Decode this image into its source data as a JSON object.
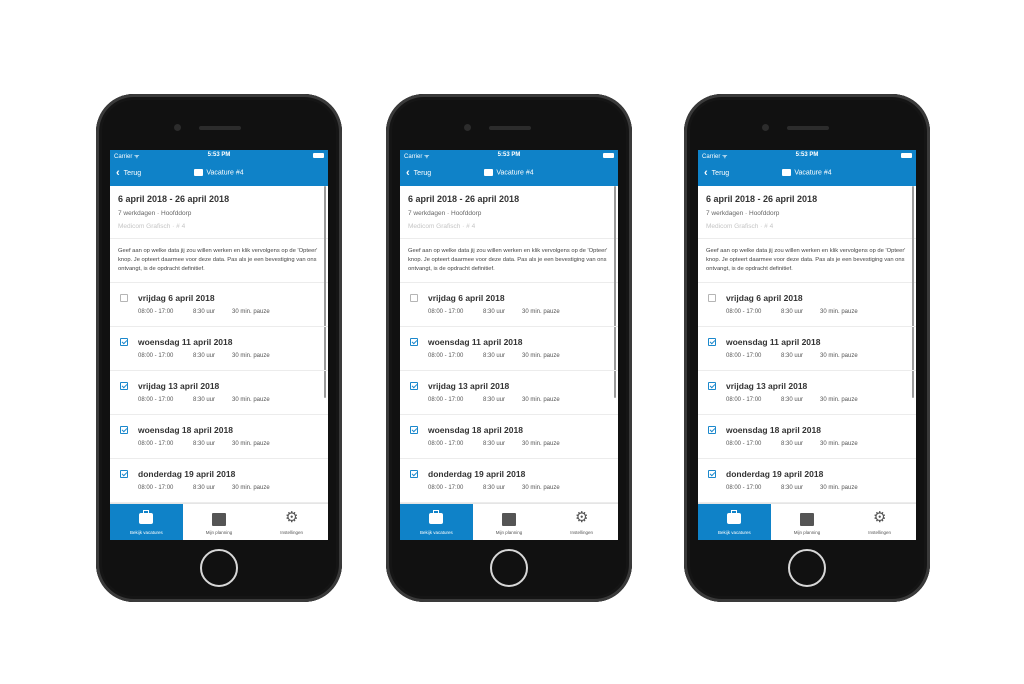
{
  "phones": [
    {
      "status": {
        "carrier": "Carrier ᯤ",
        "time": "5:53 PM"
      },
      "nav": {
        "back_label": "Terug",
        "title": "Vacature #4"
      },
      "header": {
        "dates": "6 april 2018 - 26 april 2018",
        "location": "7 werkdagen · Hoofddorp",
        "company": "Medicom Grafisch · # 4"
      },
      "intro": "Geef aan op welke data jij zou willen werken en klik vervolgens op de 'Opteer' knop. Je opteert daarmee voor deze data. Pas als je een bevestiging van ons ontvangt, is de opdracht definitief.",
      "days": [
        {
          "name": "vrijdag 6 april 2018",
          "hours": "08:00 - 17:00",
          "duration": "8:30 uur",
          "pause": "30 min. pauze",
          "checked": false
        },
        {
          "name": "woensdag 11 april 2018",
          "hours": "08:00 - 17:00",
          "duration": "8:30 uur",
          "pause": "30 min. pauze",
          "checked": true
        },
        {
          "name": "vrijdag 13 april 2018",
          "hours": "08:00 - 17:00",
          "duration": "8:30 uur",
          "pause": "30 min. pauze",
          "checked": true
        },
        {
          "name": "woensdag 18 april 2018",
          "hours": "08:00 - 17:00",
          "duration": "8:30 uur",
          "pause": "30 min. pauze",
          "checked": true
        },
        {
          "name": "donderdag 19 april 2018",
          "hours": "08:00 - 17:00",
          "duration": "8:30 uur",
          "pause": "30 min. pauze",
          "checked": true
        }
      ],
      "tabs": [
        {
          "label": "Bekijk vacatures",
          "icon": "briefcase-icon"
        },
        {
          "label": "Mijn planning",
          "icon": "calendar-icon"
        },
        {
          "label": "Instellingen",
          "icon": "gears-icon"
        }
      ]
    },
    {
      "status": {
        "carrier": "Carrier ᯤ",
        "time": "5:53 PM"
      },
      "nav": {
        "back_label": "Terug",
        "title": "Vacature #4"
      },
      "header": {
        "dates": "6 april 2018 - 26 april 2018",
        "location": "7 werkdagen · Hoofddorp",
        "company": "Medicom Grafisch · # 4"
      },
      "intro": "Geef aan op welke data jij zou willen werken en klik vervolgens op de 'Opteer' knop. Je opteert daarmee voor deze data. Pas als je een bevestiging van ons ontvangt, is de opdracht definitief.",
      "days": [
        {
          "name": "vrijdag 6 april 2018",
          "hours": "08:00 - 17:00",
          "duration": "8:30 uur",
          "pause": "30 min. pauze",
          "checked": false
        },
        {
          "name": "woensdag 11 april 2018",
          "hours": "08:00 - 17:00",
          "duration": "8:30 uur",
          "pause": "30 min. pauze",
          "checked": true
        },
        {
          "name": "vrijdag 13 april 2018",
          "hours": "08:00 - 17:00",
          "duration": "8:30 uur",
          "pause": "30 min. pauze",
          "checked": true
        },
        {
          "name": "woensdag 18 april 2018",
          "hours": "08:00 - 17:00",
          "duration": "8:30 uur",
          "pause": "30 min. pauze",
          "checked": true
        },
        {
          "name": "donderdag 19 april 2018",
          "hours": "08:00 - 17:00",
          "duration": "8:30 uur",
          "pause": "30 min. pauze",
          "checked": true
        }
      ],
      "tabs": [
        {
          "label": "Bekijk vacatures",
          "icon": "briefcase-icon"
        },
        {
          "label": "Mijn planning",
          "icon": "calendar-icon"
        },
        {
          "label": "Instellingen",
          "icon": "gears-icon"
        }
      ]
    },
    {
      "status": {
        "carrier": "Carrier ᯤ",
        "time": "5:53 PM"
      },
      "nav": {
        "back_label": "Terug",
        "title": "Vacature #4"
      },
      "header": {
        "dates": "6 april 2018 - 26 april 2018",
        "location": "7 werkdagen · Hoofddorp",
        "company": "Medicom Grafisch · # 4"
      },
      "intro": "Geef aan op welke data jij zou willen werken en klik vervolgens op de 'Opteer' knop. Je opteert daarmee voor deze data. Pas als je een bevestiging van ons ontvangt, is de opdracht definitief.",
      "days": [
        {
          "name": "vrijdag 6 april 2018",
          "hours": "08:00 - 17:00",
          "duration": "8:30 uur",
          "pause": "30 min. pauze",
          "checked": false
        },
        {
          "name": "woensdag 11 april 2018",
          "hours": "08:00 - 17:00",
          "duration": "8:30 uur",
          "pause": "30 min. pauze",
          "checked": true
        },
        {
          "name": "vrijdag 13 april 2018",
          "hours": "08:00 - 17:00",
          "duration": "8:30 uur",
          "pause": "30 min. pauze",
          "checked": true
        },
        {
          "name": "woensdag 18 april 2018",
          "hours": "08:00 - 17:00",
          "duration": "8:30 uur",
          "pause": "30 min. pauze",
          "checked": true
        },
        {
          "name": "donderdag 19 april 2018",
          "hours": "08:00 - 17:00",
          "duration": "8:30 uur",
          "pause": "30 min. pauze",
          "checked": true
        }
      ],
      "tabs": [
        {
          "label": "Bekijk vacatures",
          "icon": "briefcase-icon"
        },
        {
          "label": "Mijn planning",
          "icon": "calendar-icon"
        },
        {
          "label": "Instellingen",
          "icon": "gears-icon"
        }
      ]
    }
  ],
  "colors": {
    "accent": "#0f82c8",
    "check": "#1b88cc"
  }
}
